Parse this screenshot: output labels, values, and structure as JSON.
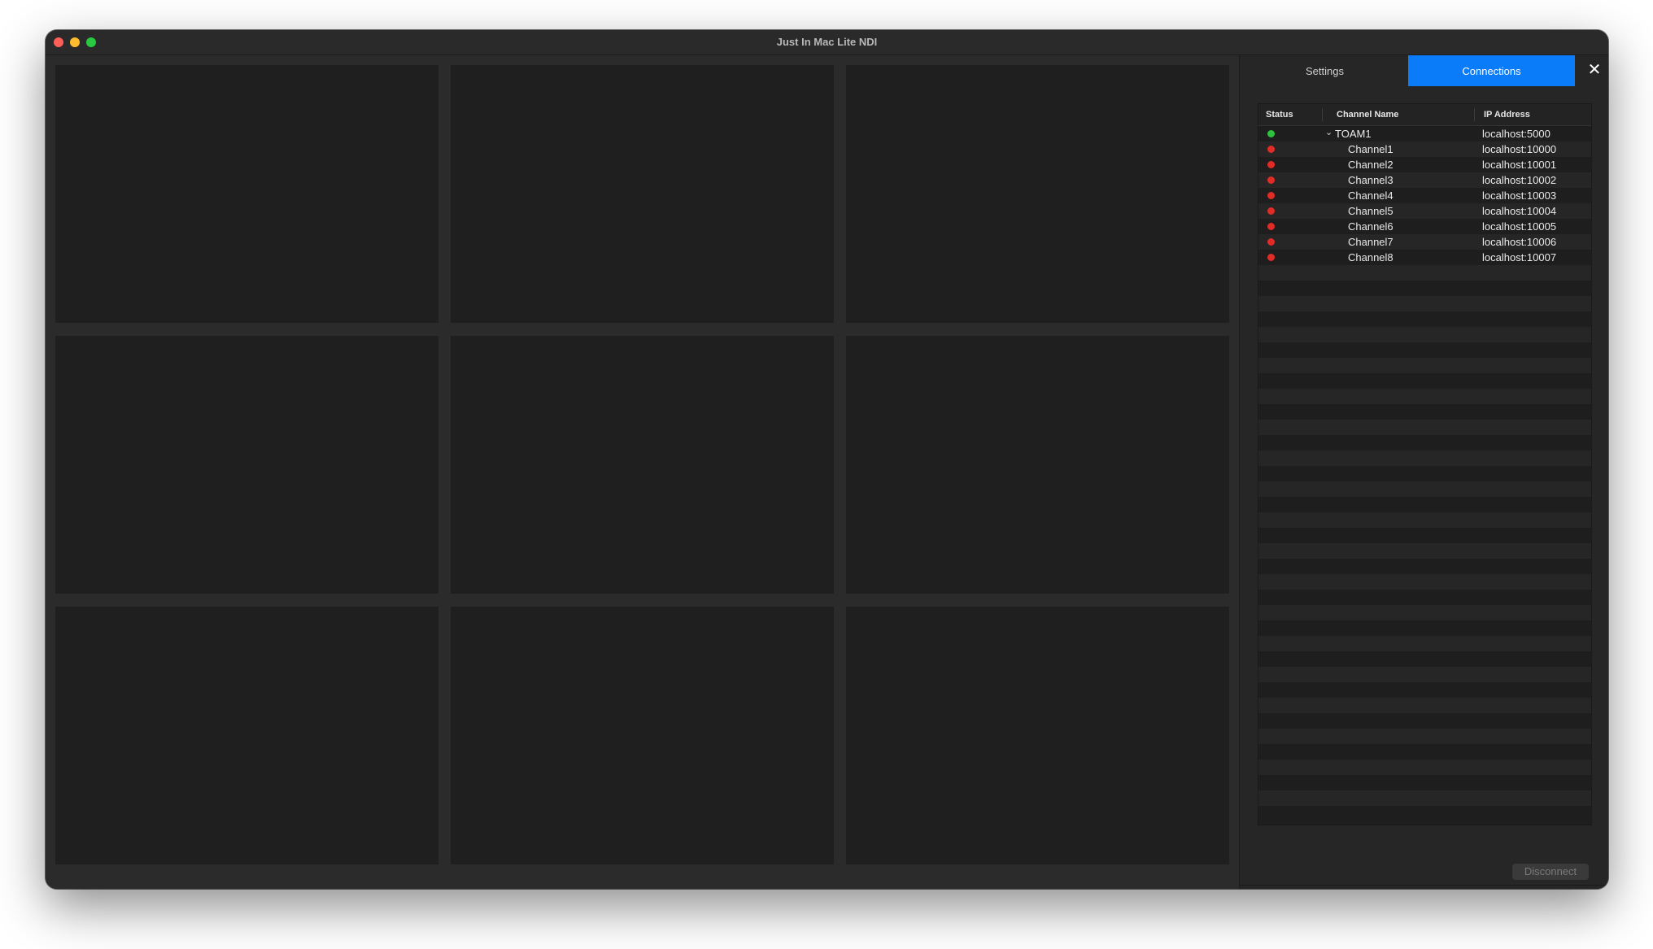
{
  "window": {
    "title": "Just In Mac Lite NDI"
  },
  "tabs": {
    "settings_label": "Settings",
    "connections_label": "Connections",
    "active": "Connections",
    "active_color": "#0a7bf9"
  },
  "close_icon": "✕",
  "table": {
    "columns": [
      "Status",
      "Channel Name",
      "IP Address"
    ],
    "rows": [
      {
        "status": "green",
        "name": "TOAM1",
        "ip": "localhost:5000",
        "group": true,
        "expanded_icon": "⌄"
      },
      {
        "status": "red",
        "name": "Channel1",
        "ip": "localhost:10000"
      },
      {
        "status": "red",
        "name": "Channel2",
        "ip": "localhost:10001"
      },
      {
        "status": "red",
        "name": "Channel3",
        "ip": "localhost:10002"
      },
      {
        "status": "red",
        "name": "Channel4",
        "ip": "localhost:10003"
      },
      {
        "status": "red",
        "name": "Channel5",
        "ip": "localhost:10004"
      },
      {
        "status": "red",
        "name": "Channel6",
        "ip": "localhost:10005"
      },
      {
        "status": "red",
        "name": "Channel7",
        "ip": "localhost:10006"
      },
      {
        "status": "red",
        "name": "Channel8",
        "ip": "localhost:10007"
      }
    ],
    "status_colors": {
      "green": "#2ec23c",
      "red": "#e12b26"
    }
  },
  "disconnect_label": "Disconnect"
}
